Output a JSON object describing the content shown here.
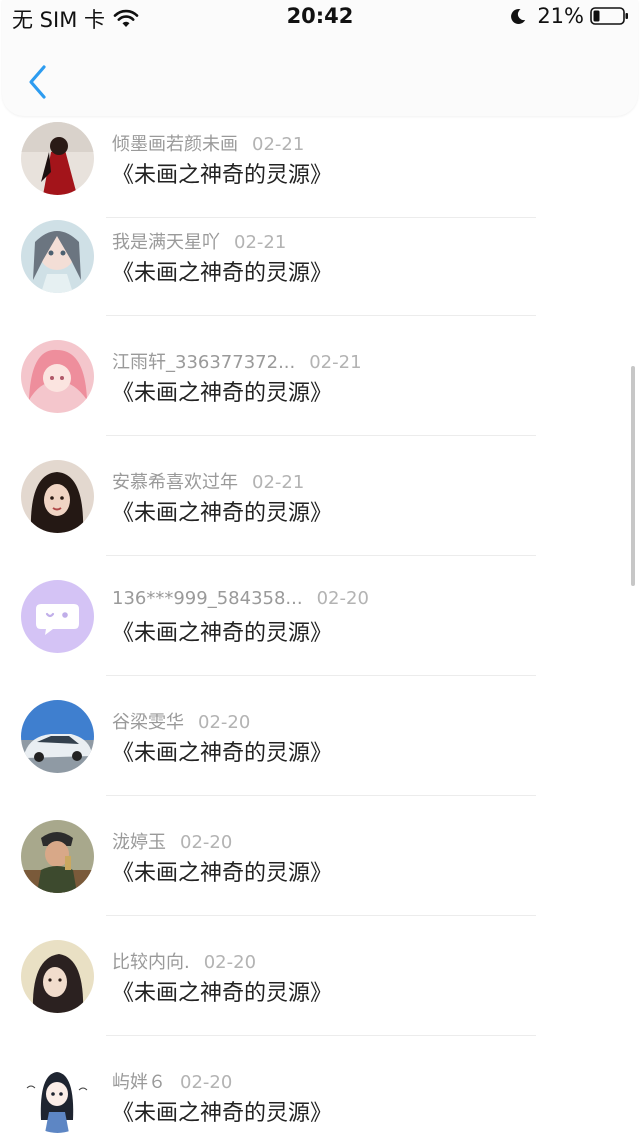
{
  "status_bar": {
    "carrier": "无 SIM 卡",
    "time": "20:42",
    "battery": "21%"
  },
  "items": [
    {
      "name": "倾墨画若颜未画",
      "date": "02-21",
      "title": "《未画之神奇的灵源》",
      "avatar": "avatar-red-dress"
    },
    {
      "name": "我是满天星吖",
      "date": "02-21",
      "title": "《未画之神奇的灵源》",
      "avatar": "avatar-anime-girl"
    },
    {
      "name": "江雨轩_336377372...",
      "date": "02-21",
      "title": "《未画之神奇的灵源》",
      "avatar": "avatar-pink-anime"
    },
    {
      "name": "安慕希喜欢过年",
      "date": "02-21",
      "title": "《未画之神奇的灵源》",
      "avatar": "avatar-girl-photo"
    },
    {
      "name": "136***999_584358...",
      "date": "02-20",
      "title": "《未画之神奇的灵源》",
      "avatar": "avatar-default-chat"
    },
    {
      "name": "谷梁雯华",
      "date": "02-20",
      "title": "《未画之神奇的灵源》",
      "avatar": "avatar-car"
    },
    {
      "name": "泷婷玉",
      "date": "02-20",
      "title": "《未画之神奇的灵源》",
      "avatar": "avatar-boy-photo"
    },
    {
      "name": "比较内向.",
      "date": "02-20",
      "title": "《未画之神奇的灵源》",
      "avatar": "avatar-woman-photo"
    },
    {
      "name": "屿姅６",
      "date": "02-20",
      "title": "《未画之神奇的灵源》",
      "avatar": "avatar-chibi-drawing"
    }
  ],
  "colors": {
    "accent": "#2d9cf0",
    "name_text": "#9a9a9a",
    "title_text": "#222222",
    "default_avatar_bg": "#d4c3f5"
  }
}
